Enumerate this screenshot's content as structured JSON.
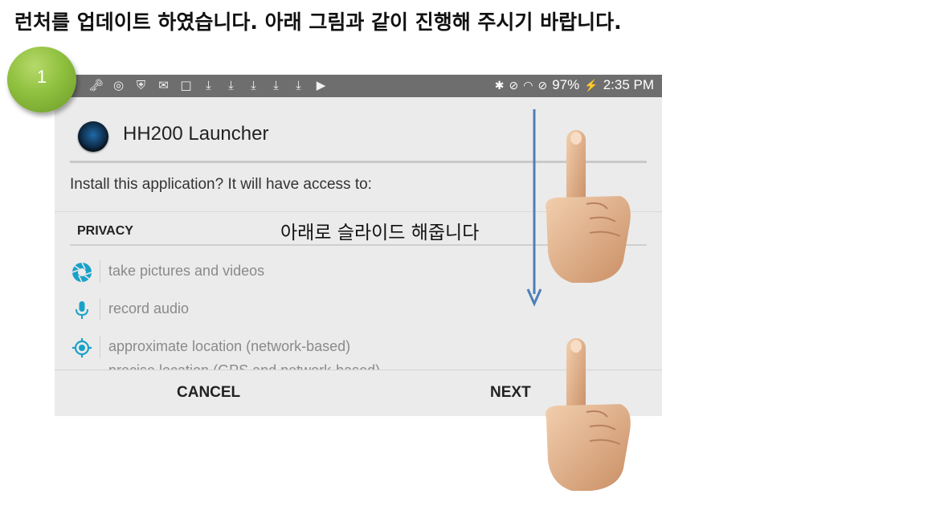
{
  "instruction": {
    "heading": "런처를 업데이트 하였습니다. 아래 그림과 같이 진행해 주시기 바랍니다.",
    "step_number": "1",
    "overlay_note": "아래로 슬라이드 해줍니다"
  },
  "status_bar": {
    "left_icons": [
      "key-icon",
      "target-icon",
      "shield-icon",
      "gmail-icon",
      "screen-icon",
      "download-icon",
      "download-icon",
      "download-icon",
      "download-icon",
      "download-icon",
      "play-store-icon"
    ],
    "right_icons": [
      "bluetooth-icon",
      "mute-icon",
      "wifi-icon",
      "do-not-disturb-icon",
      "battery-charging-icon"
    ],
    "battery": "97%",
    "time": "2:35 PM"
  },
  "dialog": {
    "app_name": "HH200 Launcher",
    "install_prompt": "Install this application? It will have access to:",
    "section_header": "PRIVACY",
    "permissions": [
      {
        "icon": "camera-shutter-icon",
        "label": "take pictures and videos"
      },
      {
        "icon": "microphone-icon",
        "label": "record audio"
      },
      {
        "icon": "location-icon",
        "label": "approximate location (network-based)"
      }
    ],
    "partial_permission": "precise location (GPS and network-based)",
    "cancel_label": "CANCEL",
    "next_label": "NEXT"
  },
  "colors": {
    "status_bar": "#6e6e6e",
    "dialog_bg": "#ebebeb",
    "icon_accent": "#1aa1c8",
    "arrow": "#4f7fb8",
    "step_circle": "#8fc03e"
  }
}
